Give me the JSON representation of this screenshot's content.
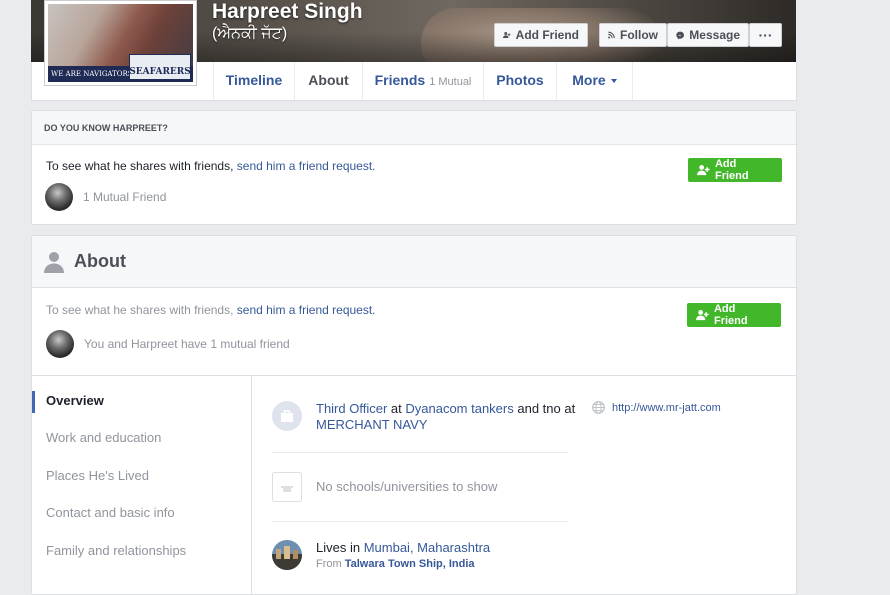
{
  "header": {
    "name": "Harpreet Singh",
    "alternate_name": "(ਐਨਕੀ ਜੱਟ)",
    "buttons": {
      "add_friend": "Add Friend",
      "follow": "Follow",
      "message": "Message",
      "more": "···"
    },
    "profile_pic": {
      "banner_text": "WE ARE NAVIGATORS",
      "logo_text": "SEAFARERS"
    }
  },
  "tabs": [
    {
      "label": "Timeline"
    },
    {
      "label": "About"
    },
    {
      "label": "Friends",
      "sub": "1 Mutual"
    },
    {
      "label": "Photos"
    },
    {
      "label": "More"
    }
  ],
  "know_card": {
    "heading": "DO YOU KNOW HARPREET?",
    "share_prefix": "To see what he shares with friends, ",
    "share_link": "send him a friend request.",
    "mutual": "1 Mutual Friend",
    "add_friend": "Add Friend"
  },
  "about_card": {
    "title": "About",
    "share_prefix": "To see what he shares with friends, ",
    "share_link": "send him a friend request.",
    "mutual": "You and Harpreet have 1 mutual friend",
    "add_friend": "Add Friend",
    "nav": [
      "Overview",
      "Work and education",
      "Places He's Lived",
      "Contact and basic info",
      "Family and relationships"
    ],
    "work": {
      "role": "Third Officer",
      "at1": " at ",
      "company": "Dyanacom tankers",
      "and": " and tno at ",
      "company2": "MERCHANT NAVY"
    },
    "education": "No schools/universities to show",
    "lives": {
      "prefix": "Lives in ",
      "city": "Mumbai, Maharashtra",
      "from_prefix": "From ",
      "from_place": "Talwara Town Ship, India"
    },
    "website": "http://www.mr-jatt.com"
  },
  "colors": {
    "link": "#365899",
    "green": "#42b72a",
    "accent": "#4267b2",
    "background": "#e9ebee"
  }
}
